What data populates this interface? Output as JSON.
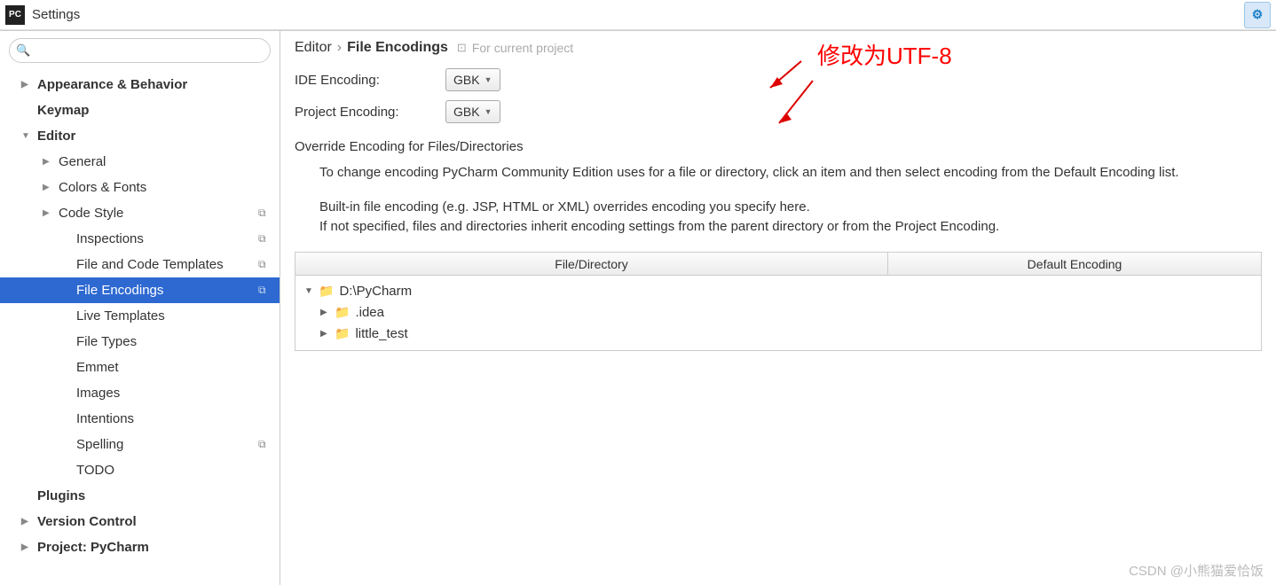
{
  "window": {
    "title": "Settings"
  },
  "sidebar": {
    "search_placeholder": "",
    "items": [
      {
        "label": "Appearance & Behavior",
        "level": 1,
        "state": "collapsed"
      },
      {
        "label": "Keymap",
        "level": 1,
        "state": "leaf"
      },
      {
        "label": "Editor",
        "level": 1,
        "state": "expanded"
      },
      {
        "label": "General",
        "level": 2,
        "state": "collapsed"
      },
      {
        "label": "Colors & Fonts",
        "level": 2,
        "state": "collapsed"
      },
      {
        "label": "Code Style",
        "level": 2,
        "state": "collapsed",
        "badge": true
      },
      {
        "label": "Inspections",
        "level": 3,
        "state": "leaf",
        "badge": true
      },
      {
        "label": "File and Code Templates",
        "level": 3,
        "state": "leaf",
        "badge": true
      },
      {
        "label": "File Encodings",
        "level": 3,
        "state": "leaf",
        "badge": true,
        "selected": true
      },
      {
        "label": "Live Templates",
        "level": 3,
        "state": "leaf"
      },
      {
        "label": "File Types",
        "level": 3,
        "state": "leaf"
      },
      {
        "label": "Emmet",
        "level": 3,
        "state": "leaf"
      },
      {
        "label": "Images",
        "level": 3,
        "state": "leaf"
      },
      {
        "label": "Intentions",
        "level": 3,
        "state": "leaf"
      },
      {
        "label": "Spelling",
        "level": 3,
        "state": "leaf",
        "badge": true
      },
      {
        "label": "TODO",
        "level": 3,
        "state": "leaf"
      },
      {
        "label": "Plugins",
        "level": 1,
        "state": "leaf"
      },
      {
        "label": "Version Control",
        "level": 1,
        "state": "collapsed"
      },
      {
        "label": "Project: PyCharm",
        "level": 1,
        "state": "collapsed"
      }
    ]
  },
  "breadcrumb": {
    "part1": "Editor",
    "part2": "File Encodings",
    "scope": "For current project"
  },
  "encoding": {
    "ide_label": "IDE Encoding:",
    "ide_value": "GBK",
    "project_label": "Project Encoding:",
    "project_value": "GBK"
  },
  "annotation": "修改为UTF-8",
  "override": {
    "title": "Override Encoding for Files/Directories",
    "p1": "To change encoding PyCharm Community Edition uses for a file or directory, click an item and then select encoding from the Default Encoding list.",
    "p2": "Built-in file encoding (e.g. JSP, HTML or XML) overrides encoding you specify here.",
    "p3": "If not specified, files and directories inherit encoding settings from the parent directory or from the Project Encoding."
  },
  "table": {
    "col1": "File/Directory",
    "col2": "Default Encoding",
    "rows": [
      {
        "label": "D:\\PyCharm",
        "state": "exp",
        "depth": 0
      },
      {
        "label": ".idea",
        "state": "col",
        "depth": 1
      },
      {
        "label": "little_test",
        "state": "col",
        "depth": 1
      }
    ]
  },
  "watermark": "CSDN @小熊猫爱恰饭"
}
